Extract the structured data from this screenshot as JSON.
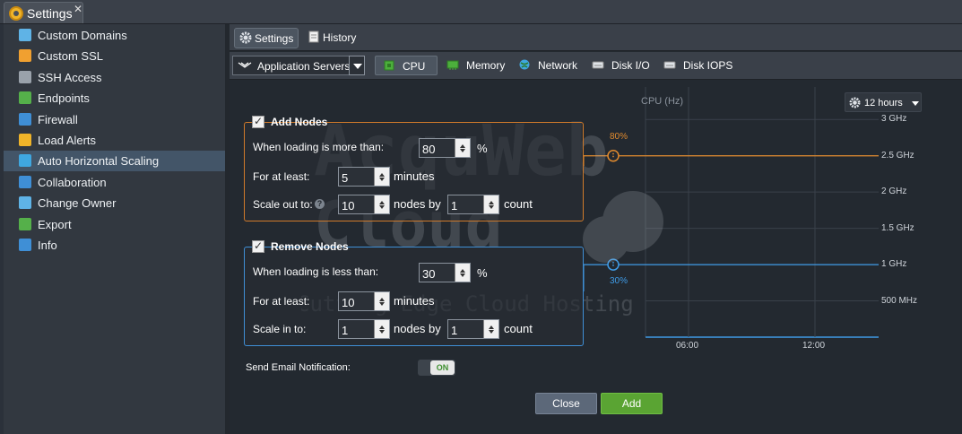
{
  "window": {
    "title": "Settings",
    "close_glyph": "✕"
  },
  "sidebar": {
    "items": [
      {
        "label": "Custom Domains",
        "icon": "globe-icon",
        "color": "#5fb3e6"
      },
      {
        "label": "Custom SSL",
        "icon": "ssl-certificate-icon",
        "color": "#f0a030"
      },
      {
        "label": "SSH Access",
        "icon": "terminal-icon",
        "color": "#9aa2ab"
      },
      {
        "label": "Endpoints",
        "icon": "endpoints-icon",
        "color": "#55b04a"
      },
      {
        "label": "Firewall",
        "icon": "shield-icon",
        "color": "#3f8fd6"
      },
      {
        "label": "Load Alerts",
        "icon": "alert-icon",
        "color": "#f0b429"
      },
      {
        "label": "Auto Horizontal Scaling",
        "icon": "scaling-icon",
        "color": "#3fa7e0"
      },
      {
        "label": "Collaboration",
        "icon": "collaboration-icon",
        "color": "#3f8fd6"
      },
      {
        "label": "Change Owner",
        "icon": "change-owner-icon",
        "color": "#5fb3e6"
      },
      {
        "label": "Export",
        "icon": "export-icon",
        "color": "#55b04a"
      },
      {
        "label": "Info",
        "icon": "info-icon",
        "color": "#3f8fd6"
      }
    ],
    "active_label": "Auto Horizontal Scaling"
  },
  "tabs": [
    {
      "label": "Settings",
      "icon": "gear-icon"
    },
    {
      "label": "History",
      "icon": "document-icon"
    }
  ],
  "toolbar": {
    "node_group": "Application Servers",
    "metrics": [
      {
        "label": "CPU",
        "icon": "cpu-icon"
      },
      {
        "label": "Memory",
        "icon": "memory-icon"
      },
      {
        "label": "Network",
        "icon": "network-icon"
      },
      {
        "label": "Disk I/O",
        "icon": "disk-io-icon"
      },
      {
        "label": "Disk IOPS",
        "icon": "disk-iops-icon"
      }
    ]
  },
  "add_nodes": {
    "title": "Add Nodes",
    "checked": true,
    "loading_label": "When loading is more than:",
    "loading_value": "80",
    "loading_unit": "%",
    "atleast_label": "For at least:",
    "atleast_value": "5",
    "atleast_unit": "minutes",
    "scale_label": "Scale out to:",
    "help_glyph": "?",
    "scale_value": "10",
    "nodes_by": "nodes by",
    "count_value": "1",
    "count_unit": "count"
  },
  "remove_nodes": {
    "title": "Remove Nodes",
    "checked": true,
    "loading_label": "When loading is less than:",
    "loading_value": "30",
    "loading_unit": "%",
    "atleast_label": "For at least:",
    "atleast_value": "10",
    "atleast_unit": "minutes",
    "scale_label": "Scale in to:",
    "scale_value": "1",
    "nodes_by": "nodes by",
    "count_value": "1",
    "count_unit": "count"
  },
  "email": {
    "label": "Send Email Notification:",
    "toggle": "ON"
  },
  "buttons": {
    "close": "Close",
    "add": "Add"
  },
  "chart": {
    "range_label": "12 hours",
    "range_icon": "gear-icon",
    "add_color": "#e08a2e",
    "remove_color": "#3f9be6"
  },
  "chart_data": {
    "type": "line",
    "title": "CPU (Hz)",
    "yticks": [
      "3 GHz",
      "2.5 GHz",
      "2 GHz",
      "1.5 GHz",
      "1 GHz",
      "500 MHz"
    ],
    "ytick_values": [
      3,
      2.5,
      2,
      1.5,
      1,
      0.5
    ],
    "xticks": [
      "06:00",
      "12:00"
    ],
    "ylim": [
      0,
      3.3
    ],
    "series": [],
    "thresholds": [
      {
        "label": "80%",
        "value": 2.5
      },
      {
        "label": "30%",
        "value": 1
      }
    ],
    "grid": true
  },
  "watermark": {
    "line1": "AcquWeb",
    "line2": "Cloud",
    "line3": "Cutting Edge Cloud Hosting"
  }
}
